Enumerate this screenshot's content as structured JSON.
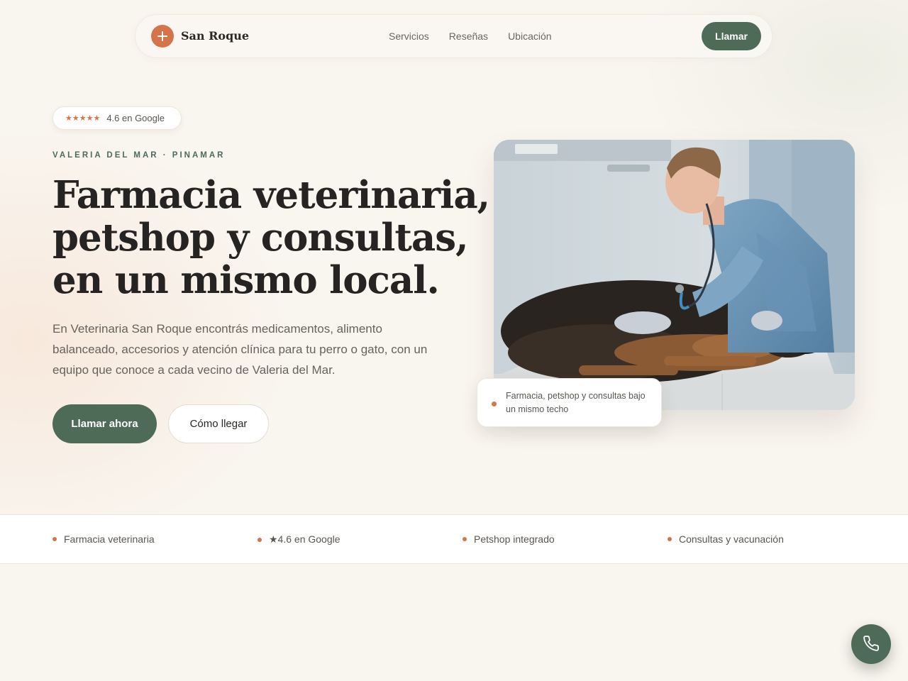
{
  "nav": {
    "brand": "San Roque",
    "links": [
      "Servicios",
      "Reseñas",
      "Ubicación"
    ],
    "call_label": "Llamar"
  },
  "hero": {
    "rating": {
      "stars": "★★★★★",
      "text": "4.6 en Google"
    },
    "eyebrow": "VALERIA DEL MAR · PINAMAR",
    "headline": [
      "Farmacia veterinaria,",
      "petshop y consultas,",
      "en un mismo local."
    ],
    "lead": "En Veterinaria San Roque encontrás medicamentos, alimento balanceado, accesorios y atención clínica para tu perro o gato, con un equipo que conoce a cada vecino de Valeria del Mar.",
    "primary_cta": "Llamar ahora",
    "secondary_cta": "Cómo llegar",
    "caption": "Farmacia, petshop y consultas bajo un mismo techo"
  },
  "features": [
    "Farmacia veterinaria",
    "★4.6 en Google",
    "Petshop integrado",
    "Consultas y vacunación"
  ],
  "icons": {
    "brand": "plus-icon",
    "fab": "phone-icon"
  },
  "colors": {
    "accent": "#d4744a",
    "primary": "#4d6b56",
    "background": "#f9f5ef",
    "text": "#262422"
  }
}
